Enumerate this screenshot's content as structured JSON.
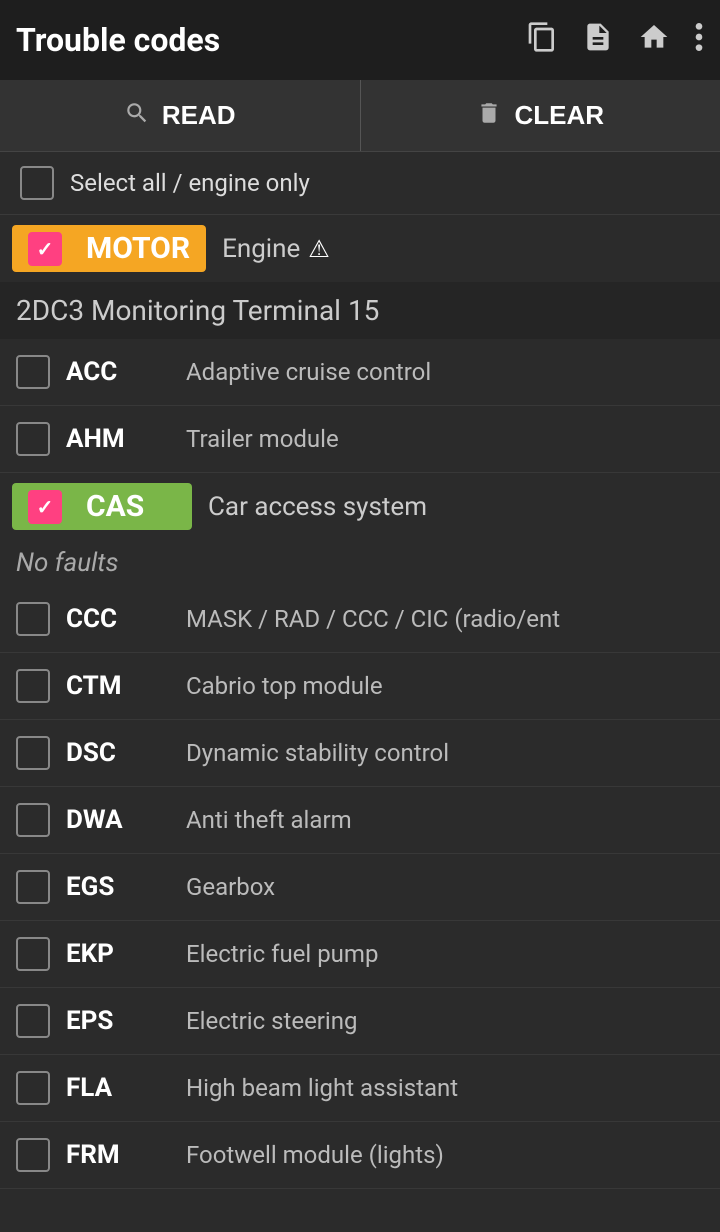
{
  "header": {
    "title": "Trouble codes",
    "icons": [
      "copy",
      "file",
      "home",
      "more"
    ]
  },
  "actions": {
    "read_label": "READ",
    "clear_label": "CLEAR"
  },
  "select_all": {
    "label": "Select all / engine only",
    "checked": false
  },
  "modules": [
    {
      "id": "MOTOR",
      "color": "orange",
      "checked": true,
      "name": "Engine",
      "has_warning": true,
      "subsection": "2DC3 Monitoring Terminal 15",
      "faults": null
    },
    {
      "id": "CAS",
      "color": "green",
      "checked": true,
      "name": "Car access system",
      "has_warning": false,
      "subsection": null,
      "faults": "No faults"
    }
  ],
  "systems": [
    {
      "code": "ACC",
      "description": "Adaptive cruise control"
    },
    {
      "code": "AHM",
      "description": "Trailer module"
    },
    {
      "code": "CCC",
      "description": "MASK / RAD / CCC / CIC (radio/ent"
    },
    {
      "code": "CTM",
      "description": "Cabrio top module"
    },
    {
      "code": "DSC",
      "description": "Dynamic stability control"
    },
    {
      "code": "DWA",
      "description": "Anti theft alarm"
    },
    {
      "code": "EGS",
      "description": "Gearbox"
    },
    {
      "code": "EKP",
      "description": "Electric fuel pump"
    },
    {
      "code": "EPS",
      "description": "Electric steering"
    },
    {
      "code": "FLA",
      "description": "High beam light assistant"
    },
    {
      "code": "FRM",
      "description": "Footwell module (lights)"
    }
  ]
}
